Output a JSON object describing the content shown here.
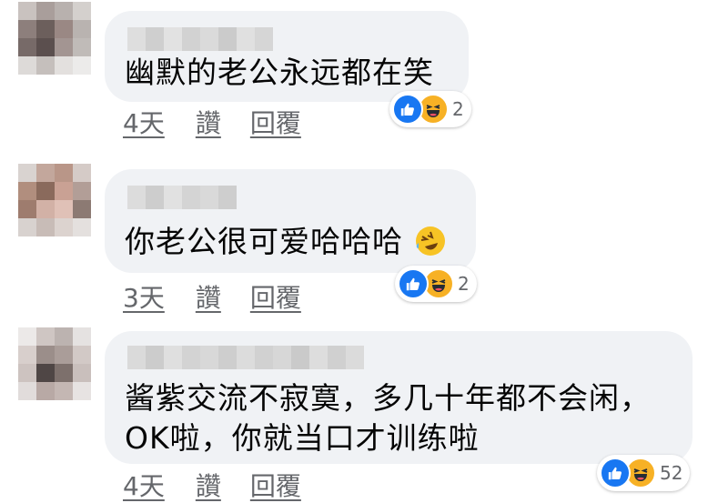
{
  "comments": [
    {
      "text_lines": [
        "幽默的老公永远都在笑"
      ],
      "reaction_count": "2",
      "actions": {
        "time": "4天",
        "like": "讚",
        "reply": "回覆"
      }
    },
    {
      "text_lines": [
        "你老公很可爱哈哈哈"
      ],
      "emoji": "rofl-emoji",
      "reaction_count": "2",
      "actions": {
        "time": "3天",
        "like": "讚",
        "reply": "回覆"
      }
    },
    {
      "text_lines": [
        "酱紫交流不寂寞，多几十年都不会闲，",
        "OK啦，你就当口才训练啦"
      ],
      "reaction_count": "52",
      "actions": {
        "time": "4天",
        "like": "讚",
        "reply": "回覆"
      }
    }
  ],
  "icons": {
    "like": "like-icon",
    "haha": "haha-icon",
    "avatar": "blurred-avatar",
    "name": "blurred-name"
  },
  "colors": {
    "bubble": "#f0f2f5",
    "like_blue": "#1877f2",
    "haha_yellow": "#f7b125",
    "meta_gray": "#65676b"
  }
}
